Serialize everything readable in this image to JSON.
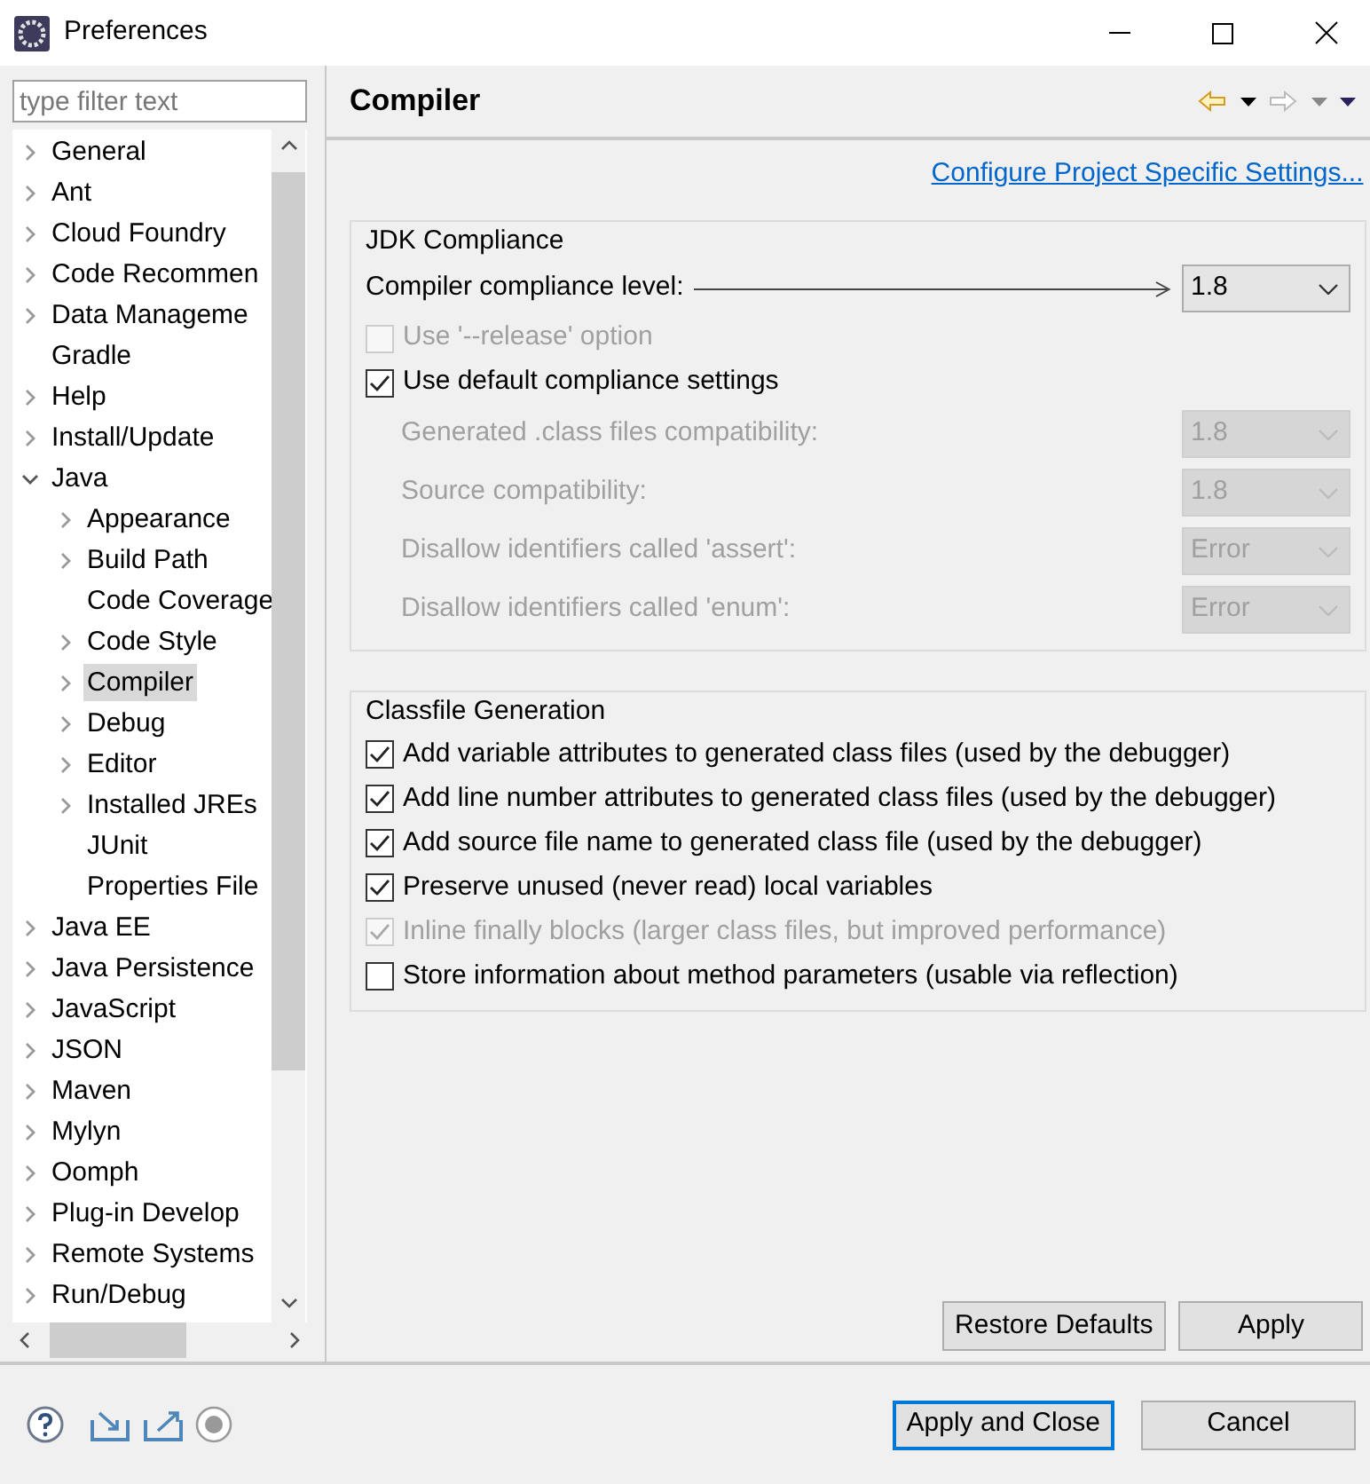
{
  "window": {
    "title": "Preferences"
  },
  "filter": {
    "placeholder": "type filter text"
  },
  "tree": [
    {
      "label": "General",
      "kind": "folder",
      "expanded": false,
      "selected": false
    },
    {
      "label": "Ant",
      "kind": "folder",
      "expanded": false,
      "selected": false
    },
    {
      "label": "Cloud Foundry",
      "kind": "folder",
      "expanded": false,
      "selected": false
    },
    {
      "label": "Code Recommen",
      "kind": "folder",
      "expanded": false,
      "selected": false
    },
    {
      "label": "Data Manageme",
      "kind": "folder",
      "expanded": false,
      "selected": false
    },
    {
      "label": "Gradle",
      "kind": "leaf",
      "selected": false
    },
    {
      "label": "Help",
      "kind": "folder",
      "expanded": false,
      "selected": false
    },
    {
      "label": "Install/Update",
      "kind": "folder",
      "expanded": false,
      "selected": false
    },
    {
      "label": "Java",
      "kind": "folder",
      "expanded": true,
      "selected": false,
      "children": [
        {
          "label": "Appearance",
          "kind": "folder",
          "expanded": false,
          "selected": false
        },
        {
          "label": "Build Path",
          "kind": "folder",
          "expanded": false,
          "selected": false
        },
        {
          "label": "Code Coverage",
          "kind": "leaf",
          "selected": false
        },
        {
          "label": "Code Style",
          "kind": "folder",
          "expanded": false,
          "selected": false
        },
        {
          "label": "Compiler",
          "kind": "folder",
          "expanded": false,
          "selected": true
        },
        {
          "label": "Debug",
          "kind": "folder",
          "expanded": false,
          "selected": false
        },
        {
          "label": "Editor",
          "kind": "folder",
          "expanded": false,
          "selected": false
        },
        {
          "label": "Installed JREs",
          "kind": "folder",
          "expanded": false,
          "selected": false
        },
        {
          "label": "JUnit",
          "kind": "leaf",
          "selected": false
        },
        {
          "label": "Properties File",
          "kind": "leaf",
          "selected": false
        }
      ]
    },
    {
      "label": "Java EE",
      "kind": "folder",
      "expanded": false,
      "selected": false
    },
    {
      "label": "Java Persistence",
      "kind": "folder",
      "expanded": false,
      "selected": false
    },
    {
      "label": "JavaScript",
      "kind": "folder",
      "expanded": false,
      "selected": false
    },
    {
      "label": "JSON",
      "kind": "folder",
      "expanded": false,
      "selected": false
    },
    {
      "label": "Maven",
      "kind": "folder",
      "expanded": false,
      "selected": false
    },
    {
      "label": "Mylyn",
      "kind": "folder",
      "expanded": false,
      "selected": false
    },
    {
      "label": "Oomph",
      "kind": "folder",
      "expanded": false,
      "selected": false
    },
    {
      "label": "Plug-in Develop",
      "kind": "folder",
      "expanded": false,
      "selected": false
    },
    {
      "label": "Remote Systems",
      "kind": "folder",
      "expanded": false,
      "selected": false
    },
    {
      "label": "Run/Debug",
      "kind": "folder",
      "expanded": false,
      "selected": false
    }
  ],
  "page": {
    "title": "Compiler",
    "link": "Configure Project Specific Settings..."
  },
  "jdk_compliance": {
    "title": "JDK Compliance",
    "level_label": "Compiler compliance level:",
    "level_value": "1.8",
    "options": [
      {
        "label": "Use '--release' option",
        "checked": false,
        "disabled": true
      },
      {
        "label": "Use default compliance settings",
        "checked": true,
        "disabled": false
      }
    ],
    "settings": [
      {
        "label": "Generated .class files compatibility:",
        "value": "1.8",
        "disabled": true
      },
      {
        "label": "Source compatibility:",
        "value": "1.8",
        "disabled": true
      },
      {
        "label": "Disallow identifiers called 'assert':",
        "value": "Error",
        "disabled": true
      },
      {
        "label": "Disallow identifiers called 'enum':",
        "value": "Error",
        "disabled": true
      }
    ]
  },
  "classfile_generation": {
    "title": "Classfile Generation",
    "options": [
      {
        "label": "Add variable attributes to generated class files (used by the debugger)",
        "checked": true,
        "disabled": false
      },
      {
        "label": "Add line number attributes to generated class files (used by the debugger)",
        "checked": true,
        "disabled": false
      },
      {
        "label": "Add source file name to generated class file (used by the debugger)",
        "checked": true,
        "disabled": false
      },
      {
        "label": "Preserve unused (never read) local variables",
        "checked": true,
        "disabled": false
      },
      {
        "label": "Inline finally blocks (larger class files, but improved performance)",
        "checked": true,
        "disabled": true
      },
      {
        "label": "Store information about method parameters (usable via reflection)",
        "checked": false,
        "disabled": false
      }
    ]
  },
  "page_buttons": [
    {
      "label": "Restore Defaults",
      "default": false
    },
    {
      "label": "Apply",
      "default": false
    }
  ],
  "dialog_buttons": [
    {
      "label": "Apply and Close",
      "default": true
    },
    {
      "label": "Cancel",
      "default": false
    }
  ]
}
